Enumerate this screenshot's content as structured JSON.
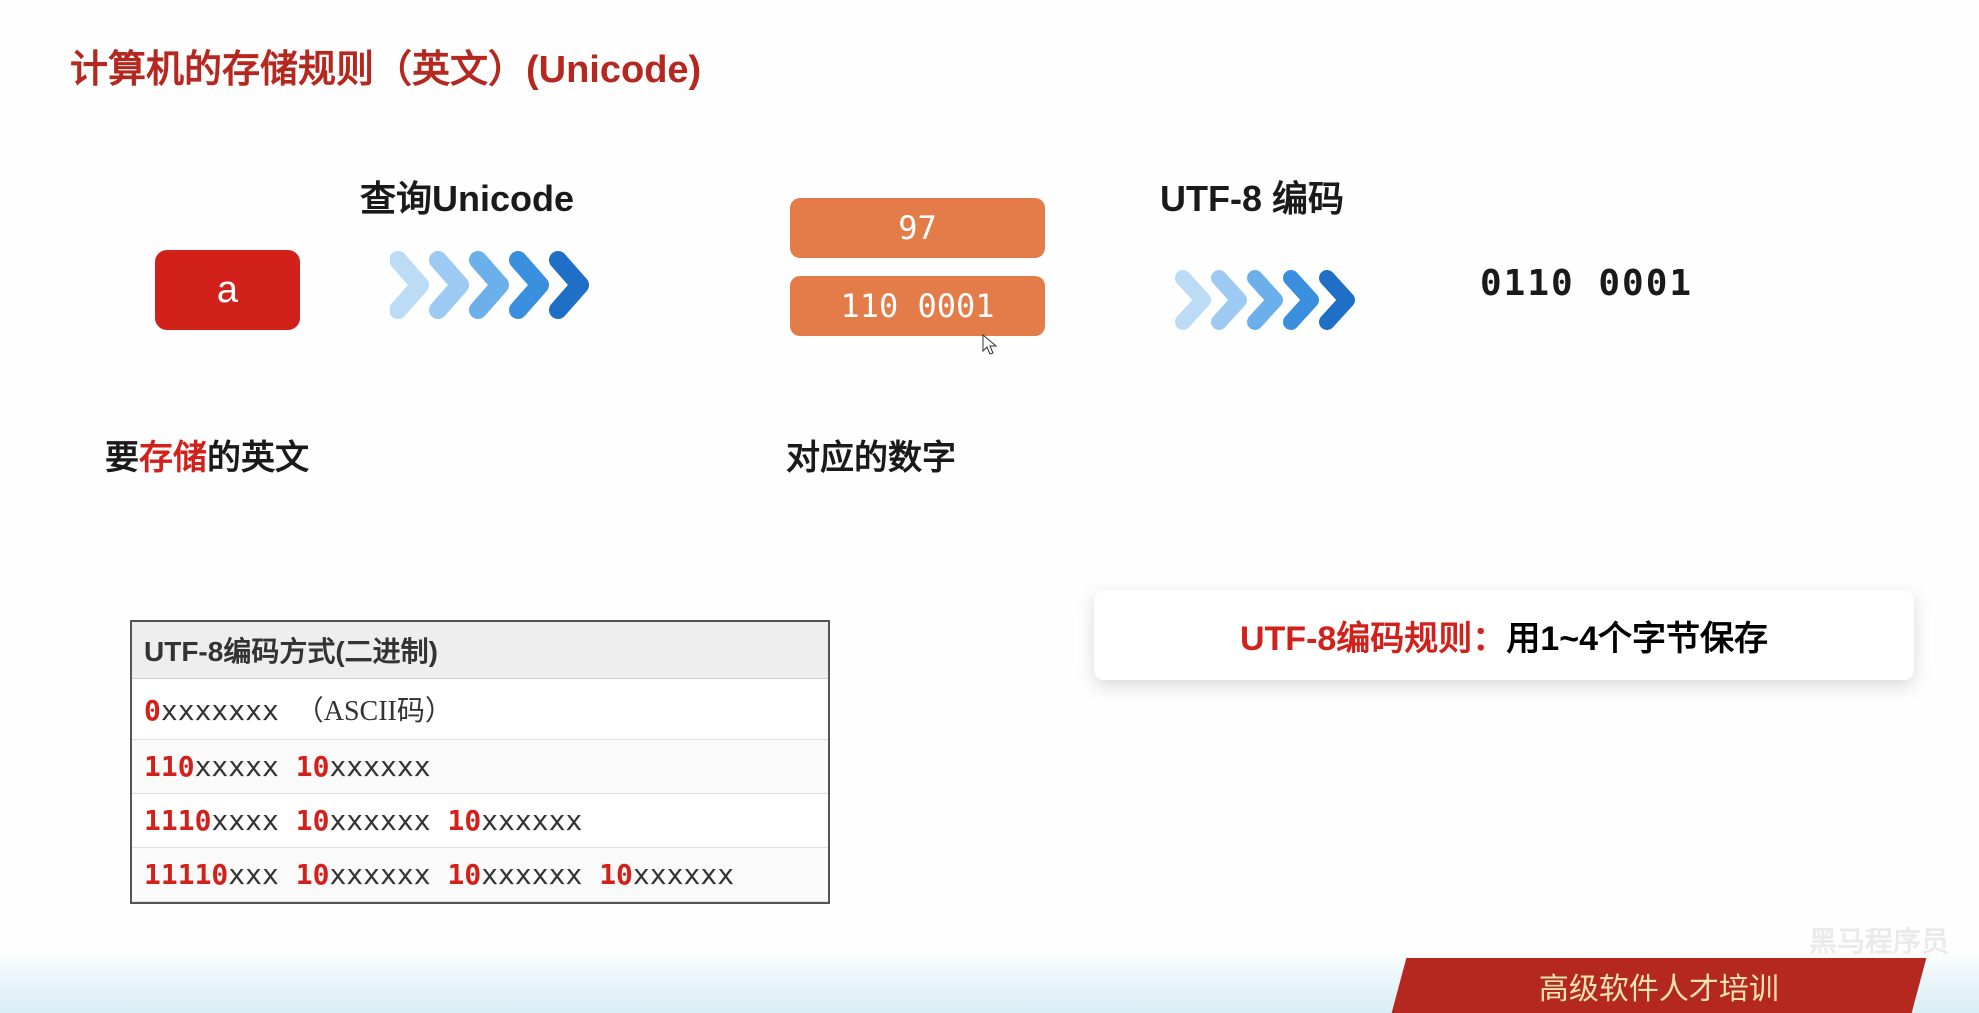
{
  "title": "计算机的存储规则（英文）(Unicode)",
  "flow": {
    "char": "a",
    "unicode_label": "查询Unicode",
    "decimal_value": "97",
    "binary_value": "110 0001",
    "utf8_label": "UTF-8  编码",
    "output_binary": "0110 0001",
    "caption_left_pre": "要",
    "caption_left_red": "存储",
    "caption_left_post": "的英文",
    "caption_mid": "对应的数字"
  },
  "table": {
    "header": "UTF-8编码方式(二进制)",
    "rows": [
      {
        "prefix": "0",
        "rest": "xxxxxxx",
        "note": "（ASCII码）"
      },
      {
        "prefix": "110",
        "rest": "xxxxx",
        "cont": [
          {
            "p": "10",
            "r": "xxxxxx"
          }
        ]
      },
      {
        "prefix": "1110",
        "rest": "xxxx",
        "cont": [
          {
            "p": "10",
            "r": "xxxxxx"
          },
          {
            "p": "10",
            "r": "xxxxxx"
          }
        ]
      },
      {
        "prefix": "11110",
        "rest": "xxx",
        "cont": [
          {
            "p": "10",
            "r": "xxxxxx"
          },
          {
            "p": "10",
            "r": "xxxxxx"
          },
          {
            "p": "10",
            "r": "xxxxxx"
          }
        ]
      }
    ]
  },
  "rule": {
    "red": "UTF-8编码规则：",
    "black": "用1~4个字节保存"
  },
  "banner": "高级软件人才培训",
  "watermark": "黑马程序员"
}
